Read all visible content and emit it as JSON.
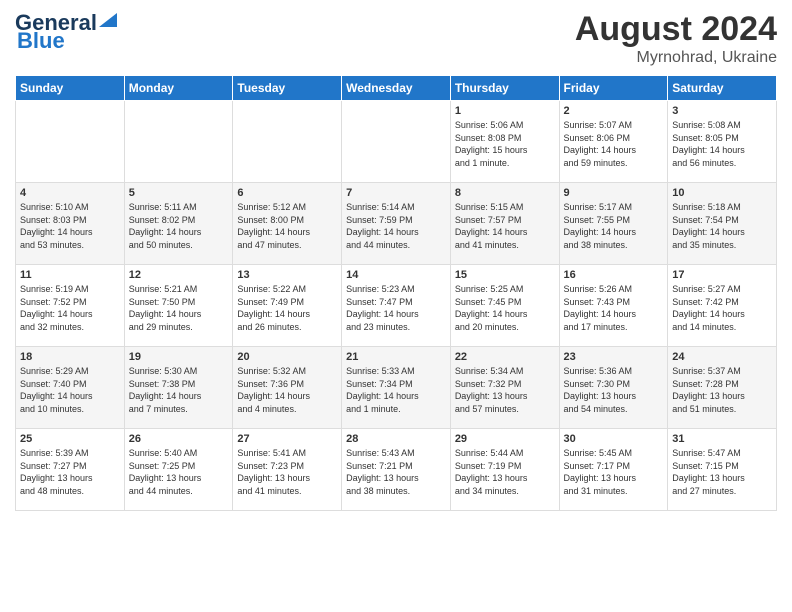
{
  "logo": {
    "part1": "General",
    "part2": "Blue"
  },
  "title": "August 2024",
  "subtitle": "Myrnohrad, Ukraine",
  "days_of_week": [
    "Sunday",
    "Monday",
    "Tuesday",
    "Wednesday",
    "Thursday",
    "Friday",
    "Saturday"
  ],
  "weeks": [
    [
      {
        "day": "",
        "info": ""
      },
      {
        "day": "",
        "info": ""
      },
      {
        "day": "",
        "info": ""
      },
      {
        "day": "",
        "info": ""
      },
      {
        "day": "1",
        "info": "Sunrise: 5:06 AM\nSunset: 8:08 PM\nDaylight: 15 hours\nand 1 minute."
      },
      {
        "day": "2",
        "info": "Sunrise: 5:07 AM\nSunset: 8:06 PM\nDaylight: 14 hours\nand 59 minutes."
      },
      {
        "day": "3",
        "info": "Sunrise: 5:08 AM\nSunset: 8:05 PM\nDaylight: 14 hours\nand 56 minutes."
      }
    ],
    [
      {
        "day": "4",
        "info": "Sunrise: 5:10 AM\nSunset: 8:03 PM\nDaylight: 14 hours\nand 53 minutes."
      },
      {
        "day": "5",
        "info": "Sunrise: 5:11 AM\nSunset: 8:02 PM\nDaylight: 14 hours\nand 50 minutes."
      },
      {
        "day": "6",
        "info": "Sunrise: 5:12 AM\nSunset: 8:00 PM\nDaylight: 14 hours\nand 47 minutes."
      },
      {
        "day": "7",
        "info": "Sunrise: 5:14 AM\nSunset: 7:59 PM\nDaylight: 14 hours\nand 44 minutes."
      },
      {
        "day": "8",
        "info": "Sunrise: 5:15 AM\nSunset: 7:57 PM\nDaylight: 14 hours\nand 41 minutes."
      },
      {
        "day": "9",
        "info": "Sunrise: 5:17 AM\nSunset: 7:55 PM\nDaylight: 14 hours\nand 38 minutes."
      },
      {
        "day": "10",
        "info": "Sunrise: 5:18 AM\nSunset: 7:54 PM\nDaylight: 14 hours\nand 35 minutes."
      }
    ],
    [
      {
        "day": "11",
        "info": "Sunrise: 5:19 AM\nSunset: 7:52 PM\nDaylight: 14 hours\nand 32 minutes."
      },
      {
        "day": "12",
        "info": "Sunrise: 5:21 AM\nSunset: 7:50 PM\nDaylight: 14 hours\nand 29 minutes."
      },
      {
        "day": "13",
        "info": "Sunrise: 5:22 AM\nSunset: 7:49 PM\nDaylight: 14 hours\nand 26 minutes."
      },
      {
        "day": "14",
        "info": "Sunrise: 5:23 AM\nSunset: 7:47 PM\nDaylight: 14 hours\nand 23 minutes."
      },
      {
        "day": "15",
        "info": "Sunrise: 5:25 AM\nSunset: 7:45 PM\nDaylight: 14 hours\nand 20 minutes."
      },
      {
        "day": "16",
        "info": "Sunrise: 5:26 AM\nSunset: 7:43 PM\nDaylight: 14 hours\nand 17 minutes."
      },
      {
        "day": "17",
        "info": "Sunrise: 5:27 AM\nSunset: 7:42 PM\nDaylight: 14 hours\nand 14 minutes."
      }
    ],
    [
      {
        "day": "18",
        "info": "Sunrise: 5:29 AM\nSunset: 7:40 PM\nDaylight: 14 hours\nand 10 minutes."
      },
      {
        "day": "19",
        "info": "Sunrise: 5:30 AM\nSunset: 7:38 PM\nDaylight: 14 hours\nand 7 minutes."
      },
      {
        "day": "20",
        "info": "Sunrise: 5:32 AM\nSunset: 7:36 PM\nDaylight: 14 hours\nand 4 minutes."
      },
      {
        "day": "21",
        "info": "Sunrise: 5:33 AM\nSunset: 7:34 PM\nDaylight: 14 hours\nand 1 minute."
      },
      {
        "day": "22",
        "info": "Sunrise: 5:34 AM\nSunset: 7:32 PM\nDaylight: 13 hours\nand 57 minutes."
      },
      {
        "day": "23",
        "info": "Sunrise: 5:36 AM\nSunset: 7:30 PM\nDaylight: 13 hours\nand 54 minutes."
      },
      {
        "day": "24",
        "info": "Sunrise: 5:37 AM\nSunset: 7:28 PM\nDaylight: 13 hours\nand 51 minutes."
      }
    ],
    [
      {
        "day": "25",
        "info": "Sunrise: 5:39 AM\nSunset: 7:27 PM\nDaylight: 13 hours\nand 48 minutes."
      },
      {
        "day": "26",
        "info": "Sunrise: 5:40 AM\nSunset: 7:25 PM\nDaylight: 13 hours\nand 44 minutes."
      },
      {
        "day": "27",
        "info": "Sunrise: 5:41 AM\nSunset: 7:23 PM\nDaylight: 13 hours\nand 41 minutes."
      },
      {
        "day": "28",
        "info": "Sunrise: 5:43 AM\nSunset: 7:21 PM\nDaylight: 13 hours\nand 38 minutes."
      },
      {
        "day": "29",
        "info": "Sunrise: 5:44 AM\nSunset: 7:19 PM\nDaylight: 13 hours\nand 34 minutes."
      },
      {
        "day": "30",
        "info": "Sunrise: 5:45 AM\nSunset: 7:17 PM\nDaylight: 13 hours\nand 31 minutes."
      },
      {
        "day": "31",
        "info": "Sunrise: 5:47 AM\nSunset: 7:15 PM\nDaylight: 13 hours\nand 27 minutes."
      }
    ]
  ]
}
